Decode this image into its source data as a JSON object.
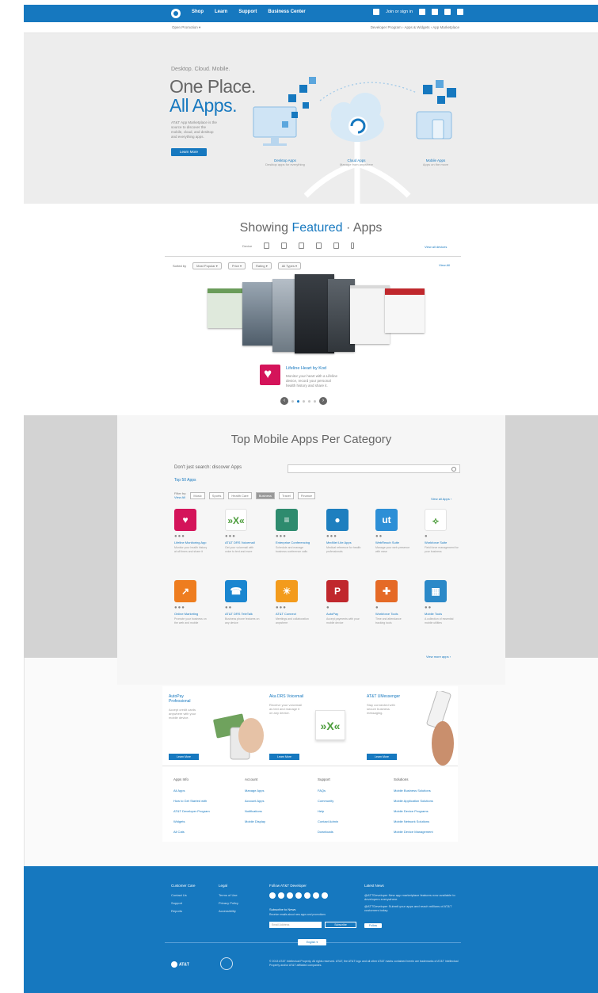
{
  "nav": {
    "items": [
      "Shop",
      "Learn",
      "Support",
      "Business Center"
    ],
    "right_label": "Join or sign in"
  },
  "subnav": {
    "left": "Open Promotion ▾",
    "right": "Developer Program › Apps & Widgets › App Marketplace"
  },
  "hero": {
    "kicker": "Desktop. Cloud. Mobile.",
    "title_line1": "One Place.",
    "title_line2": "All Apps.",
    "description": "AT&T App Marketplace is the source to discover the mobile, cloud, and desktop and everything apps.",
    "button": "Learn More",
    "captions": [
      {
        "label": "Desktop Apps",
        "sub": "Desktop apps for everything"
      },
      {
        "label": "Cloud Apps",
        "sub": "Manage from anywhere"
      },
      {
        "label": "Mobile Apps",
        "sub": "Apps on the move"
      }
    ]
  },
  "featured": {
    "title_pre": "Showing",
    "title_accent": "Featured",
    "title_post": "Apps",
    "icons_label": "Device",
    "icons": [
      "desktop-icon",
      "tablet-icon",
      "phone-icon",
      "printer-icon",
      "cloud-icon",
      "bottle-icon"
    ],
    "right_link": "View all devices",
    "filters_label": "Sorted by",
    "filters": [
      "Most Popular ▾",
      "Price ▾",
      "Rating ▾",
      "All Types ▾"
    ],
    "filters_link": "View All",
    "item": {
      "name": "Lifeline Heart by Kod",
      "description": "Monitor your heart with a Lifeline device, record your personal health history and share it."
    },
    "pager": {
      "total": 5,
      "active": 1
    }
  },
  "top_apps": {
    "title": "Top Mobile Apps Per Category",
    "search_prompt": "Don't just search: discover Apps",
    "top_link": "Top 50 Apps",
    "filter_label": "Filter by:",
    "filter_sublabel": "View All",
    "filters": [
      {
        "label": "Music",
        "selected": false
      },
      {
        "label": "Sports",
        "selected": false
      },
      {
        "label": "Health Care",
        "selected": false
      },
      {
        "label": "Business",
        "selected": true
      },
      {
        "label": "Travel",
        "selected": false
      },
      {
        "label": "Finance",
        "selected": false
      }
    ],
    "right_link": "View all Apps ›",
    "more_link": "View more apps ›",
    "apps": [
      {
        "name": "Lifeline Monitoring App",
        "rating": "●●●",
        "color": "#d4145a",
        "glyph": "♥",
        "desc": "Monitor your health history at all times and share it"
      },
      {
        "name": "AT&T DRS Voicemail",
        "rating": "●●●",
        "color": "#ffffff",
        "glyph": "»X«",
        "desc": "Get your voicemail with voice to text and more"
      },
      {
        "name": "Enterprise Conferencing",
        "rating": "●●●",
        "color": "#2e8b6e",
        "glyph": "≡",
        "desc": "Schedule and manage business conference calls"
      },
      {
        "name": "MedNet Lite Apps",
        "rating": "●●●",
        "color": "#1e7fbf",
        "glyph": "●",
        "desc": "Medical reference for health professionals"
      },
      {
        "name": "WebReach Suite",
        "rating": "●●",
        "color": "#2d8fd6",
        "glyph": "ut",
        "desc": "Manage your web presence with ease"
      },
      {
        "name": "Workforce Suite",
        "rating": "●",
        "color": "#ffffff",
        "glyph": "⟡",
        "desc": "Field force management for your business"
      },
      {
        "name": "Online Marketing",
        "rating": "●●●",
        "color": "#ee7d1f",
        "glyph": "↗",
        "desc": "Promote your business on the web and mobile"
      },
      {
        "name": "AT&T DRS TeleTalk",
        "rating": "●●",
        "color": "#1a86d0",
        "glyph": "☎",
        "desc": "Business phone features on any device"
      },
      {
        "name": "AT&T Connect",
        "rating": "●●●",
        "color": "#f39b1c",
        "glyph": "☀",
        "desc": "Meetings and collaboration anywhere"
      },
      {
        "name": "AutoPay",
        "rating": "●",
        "color": "#c0282d",
        "glyph": "P",
        "desc": "Accept payments with your mobile device"
      },
      {
        "name": "Workforce Tools",
        "rating": "●",
        "color": "#e56a26",
        "glyph": "✚",
        "desc": "Time and attendance tracking tools"
      },
      {
        "name": "Mobile Tools",
        "rating": "●●",
        "color": "#2b89c8",
        "glyph": "▦",
        "desc": "A collection of essential mobile utilities"
      }
    ]
  },
  "promo": [
    {
      "title": "AutoPay Professional",
      "desc": "Accept credit cards anywhere with your mobile device.",
      "button": "Learn More"
    },
    {
      "title": "Aka DRS Voicemail",
      "desc": "Receive your voicemail as text and manage it on any device.",
      "button": "Learn More"
    },
    {
      "title": "AT&T UMessenger",
      "desc": "Stay connected with secure business messaging.",
      "button": "Learn More"
    }
  ],
  "links": [
    {
      "heading": "Apps Info",
      "items": [
        "All Apps",
        "How to Get Started with",
        "AT&T Developer Program",
        "Widgets",
        "All Cats"
      ]
    },
    {
      "heading": "Account",
      "items": [
        "Manage Apps",
        "Account Apps",
        "Notifications",
        "Mobile Display"
      ]
    },
    {
      "heading": "Support",
      "items": [
        "FAQs",
        "Community",
        "Help",
        "Contact Admin",
        "Downloads"
      ]
    },
    {
      "heading": "Solutions",
      "items": [
        "Mobile Business Solutions",
        "Mobile Application Solutions",
        "Mobile Device Programs",
        "Mobile Network Solutions",
        "Mobile Device Management"
      ]
    }
  ],
  "footer": {
    "columns": [
      {
        "heading": "Customer Care",
        "items": [
          "Contact Us",
          "Support",
          "Reports"
        ]
      },
      {
        "heading": "Legal",
        "items": [
          "Terms of Use",
          "Privacy Policy",
          "Accessibility"
        ]
      }
    ],
    "social_heading": "Follow AT&T Developer",
    "social": [
      "facebook-icon",
      "twitter-icon",
      "youtube-icon",
      "linkedin-icon",
      "google-plus-icon",
      "rss-icon",
      "blog-icon"
    ],
    "subscribe_heading": "Subscribe to News",
    "subscribe_sub": "Receive emails about new apps and promotions",
    "email_placeholder": "Email Address",
    "subscribe_button": "Subscribe",
    "news_heading": "Latest News",
    "news": [
      "@ATTDeveloper New app marketplace features now available to developers everywhere.",
      "@ATTDeveloper Submit your apps and reach millions of AT&T customers today."
    ],
    "follow_button": "Follow",
    "language": "English ▾",
    "brand": "AT&T",
    "legal": "© 2013 AT&T Intellectual Property. All rights reserved. AT&T, the AT&T logo and all other AT&T marks contained herein are trademarks of AT&T Intellectual Property and/or AT&T affiliated companies."
  }
}
